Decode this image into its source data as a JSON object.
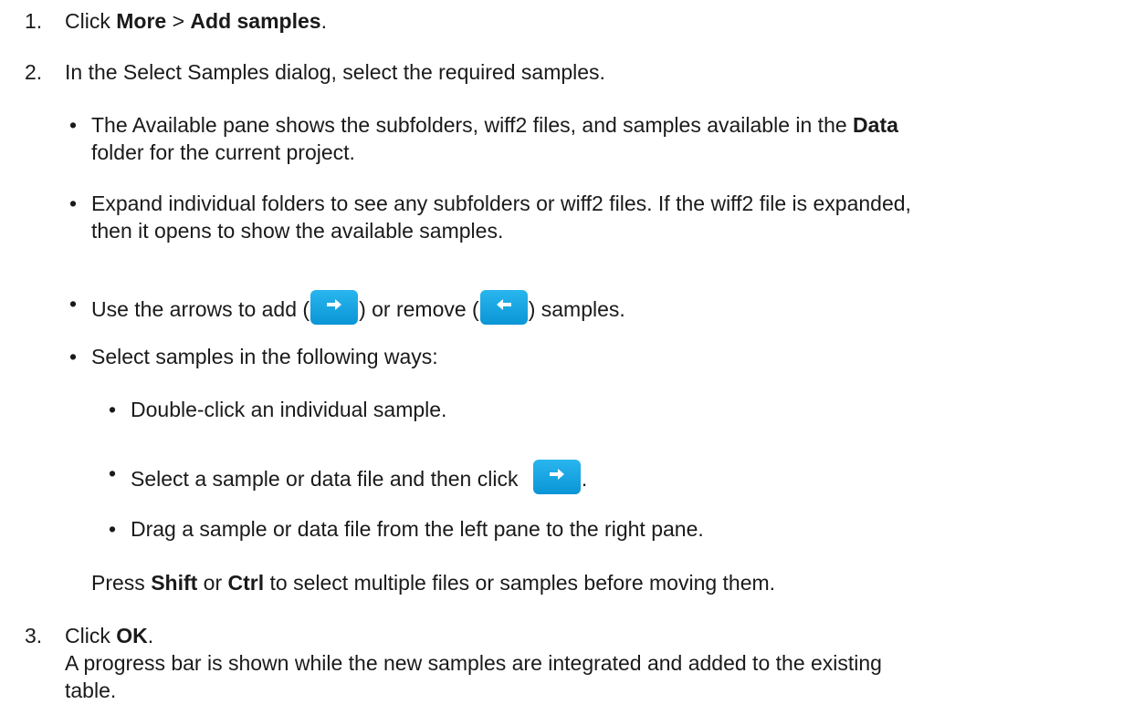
{
  "steps": {
    "s1": {
      "num": "1.",
      "click": "Click ",
      "more": "More",
      "sep": " > ",
      "add_samples": "Add samples",
      "end": "."
    },
    "s2": {
      "num": "2.",
      "text": "In the Select Samples dialog, select the required samples.",
      "b1": {
        "l1_pre": "The Available pane shows the subfolders, wiff2 files, and samples available in the ",
        "l1_bold": "Data",
        "l2": "folder for the current project."
      },
      "b2": {
        "l1": "Expand individual folders to see any subfolders or wiff2 files. If the wiff2 file is expanded,",
        "l2": "then it opens to show the available samples."
      },
      "b3": {
        "pre": "Use the arrows to add (",
        "mid": ") or remove (",
        "post": ") samples."
      },
      "b4": {
        "text": "Select samples in the following ways:"
      },
      "sub1": "Double-click an individual sample.",
      "sub2_pre": "Select a sample or data file and then click ",
      "sub2_post": ".",
      "sub3": "Drag a sample or data file from the left pane to the right pane.",
      "note": {
        "press": "Press ",
        "shift": "Shift",
        "or": " or ",
        "ctrl": "Ctrl",
        "rest": " to select multiple files or samples before moving them."
      }
    },
    "s3": {
      "num": "3.",
      "click": "Click ",
      "ok": "OK",
      "end": ".",
      "l2": "A progress bar is shown while the new samples are integrated and added to the existing",
      "l3": "table."
    }
  },
  "bullet_char": "•",
  "icons": {
    "add": "arrow-right-icon",
    "remove": "arrow-left-icon"
  },
  "colors": {
    "button": "#1aa6e2",
    "text": "#1a1a1a"
  }
}
